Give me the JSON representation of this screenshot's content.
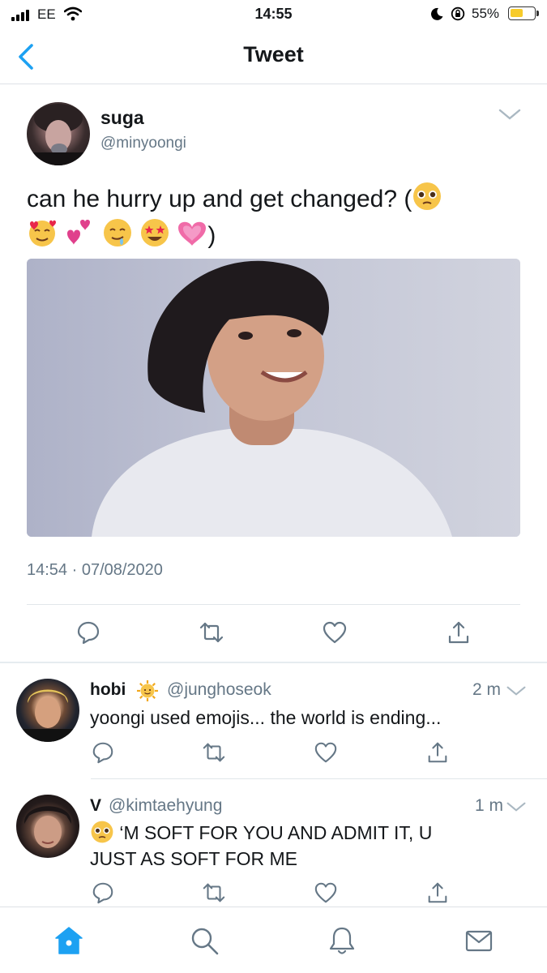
{
  "status_bar": {
    "carrier": "EE",
    "time": "14:55",
    "battery_percent": "55%",
    "battery_level": 0.55,
    "icons": [
      "signal-icon",
      "wifi-icon",
      "moon-icon",
      "rotation-lock-icon",
      "battery-icon"
    ]
  },
  "nav": {
    "title": "Tweet",
    "back_icon": "back-chevron-icon"
  },
  "tweet": {
    "name": "suga",
    "handle": "@minyoongi",
    "text_line1": "can he hurry up and get changed? (",
    "text_line2_end": ")",
    "emojis": [
      "pleading-face",
      "smiling-face-with-hearts",
      "two-hearts",
      "drooling-face",
      "star-struck",
      "growing-heart"
    ],
    "timestamp": "14:54 · 07/08/2020",
    "actions": [
      "reply-icon",
      "retweet-icon",
      "like-icon",
      "share-icon"
    ]
  },
  "replies": [
    {
      "name": "hobi",
      "name_emoji": "sun-with-face",
      "handle": "@junghoseok",
      "age": "2 m",
      "text": "yoongi used emojis... the world is ending..."
    },
    {
      "name": "V",
      "handle": "@kimtaehyung",
      "age": "1 m",
      "text_emoji": "pleading-face",
      "text_line1": " ‘M SOFT FOR YOU AND ADMIT IT, U",
      "text_line2": "JUST AS SOFT FOR ME"
    }
  ],
  "tabbar": {
    "tabs": [
      "home-icon",
      "search-icon",
      "notifications-icon",
      "messages-icon"
    ],
    "active_color": "#1da1f2"
  },
  "colors": {
    "accent": "#1da1f2",
    "secondary_text": "#657786",
    "divider": "#e1e6ea"
  }
}
